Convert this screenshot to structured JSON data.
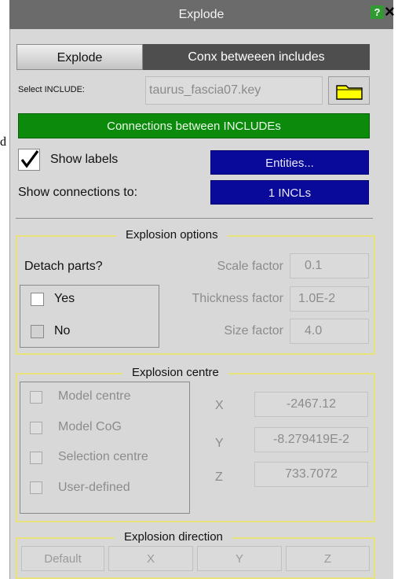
{
  "stray_char": "d",
  "window": {
    "title": "Explode",
    "help_label": "?",
    "close_label": "×"
  },
  "tabs": [
    {
      "label": "Explode"
    },
    {
      "label": "Conx betweeen includes"
    }
  ],
  "select_include": {
    "label": "Select INCLUDE:",
    "value": "taurus_fascia07.key"
  },
  "connections_bar": "Connections between INCLUDEs",
  "show_labels": {
    "label": "Show labels",
    "checked": true,
    "button": "Entities..."
  },
  "show_connections": {
    "label": "Show connections to:",
    "button": "1 INCLs"
  },
  "explosion_options": {
    "title": "Explosion options",
    "detach_label": "Detach parts?",
    "yes_label": "Yes",
    "no_label": "No",
    "scale_label": "Scale factor",
    "scale_value": "0.1",
    "thickness_label": "Thickness factor",
    "thickness_value": "1.0E-2",
    "size_label": "Size factor",
    "size_value": "4.0"
  },
  "explosion_centre": {
    "title": "Explosion centre",
    "options": [
      "Model centre",
      "Model CoG",
      "Selection centre",
      "User-defined"
    ],
    "x_label": "X",
    "x_value": "-2467.12",
    "y_label": "Y",
    "y_value": "-8.279419E-2",
    "z_label": "Z",
    "z_value": "733.7072"
  },
  "explosion_direction": {
    "title": "Explosion direction",
    "buttons": [
      "Default",
      "X",
      "Y",
      "Z"
    ]
  },
  "colors": {
    "title_bar": "#6b6b6b",
    "green_bar": "#0b8a0b",
    "blue_button": "#0a0a9a",
    "group_border": "#e8e27a",
    "folder_icon": "#ffff00"
  }
}
